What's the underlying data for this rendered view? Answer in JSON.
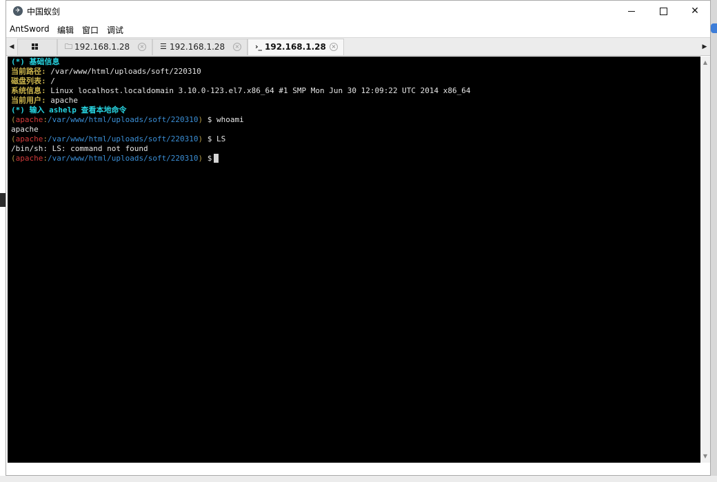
{
  "window": {
    "title": "中国蚁剑",
    "icon": "antsword-logo-icon"
  },
  "menu": [
    "AntSword",
    "编辑",
    "窗口",
    "调试"
  ],
  "tabs": [
    {
      "icon": "grid-icon",
      "label": ""
    },
    {
      "icon": "folder-icon",
      "label": "192.168.1.28"
    },
    {
      "icon": "database-icon",
      "label": "192.168.1.28"
    },
    {
      "icon": "terminal-icon",
      "label": "192.168.1.28",
      "active": true
    }
  ],
  "glyphs": {
    "folder": "🗀",
    "database": "☰",
    "terminal": "›_",
    "close": "×",
    "tab_left": "◀",
    "tab_right": "▶",
    "scroll_up": "▲",
    "scroll_down": "▼",
    "prompt_symbol": "$",
    "separator": ":",
    "open_paren": "(",
    "close_paren": ")"
  },
  "terminal": {
    "info_header": "(*) 基础信息",
    "path_label": "当前路径:",
    "path_value": " /var/www/html/uploads/soft/220310",
    "disk_label": "磁盘列表:",
    "disk_value": " /",
    "sys_label": "系统信息:",
    "sys_value": " Linux localhost.localdomain 3.10.0-123.el7.x86_64 #1 SMP Mon Jun 30 12:09:22 UTC 2014 x86_64",
    "user_label": "当前用户:",
    "user_value": " apache",
    "help_line": "(*) 输入 ashelp 查看本地命令",
    "prompt_user": "apache",
    "prompt_path": "/var/www/html/uploads/soft/220310",
    "commands": [
      {
        "cmd": " whoami",
        "output": "apache"
      },
      {
        "cmd": " LS",
        "output": "/bin/sh: LS: command not found"
      }
    ]
  },
  "colors": {
    "terminal_bg": "#000000",
    "header_cyan": "#27d3e0",
    "label_olive": "#c9b24b",
    "prompt_user_red": "#d13a3a",
    "prompt_path_blue": "#3b8fd6"
  }
}
